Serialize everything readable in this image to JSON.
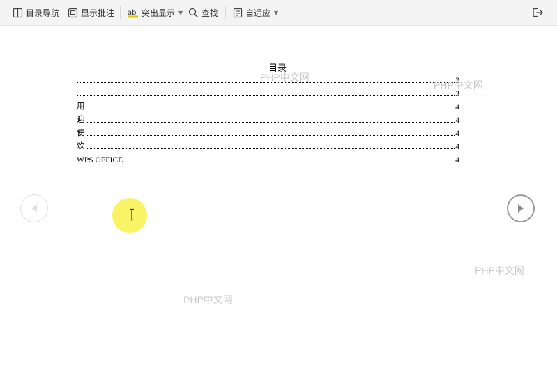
{
  "toolbar": {
    "toc_nav_label": "目录导航",
    "show_comments_label": "显示批注",
    "highlight_label": "突出显示",
    "find_label": "查找",
    "fit_label": "自适应"
  },
  "document": {
    "toc_title": "目录",
    "toc_entries": [
      {
        "text": "",
        "page": "3"
      },
      {
        "text": "",
        "page": "3"
      },
      {
        "text": "用",
        "page": "4"
      },
      {
        "text": "迎",
        "page": "4"
      },
      {
        "text": "使",
        "page": "4"
      },
      {
        "text": "欢",
        "page": "4"
      },
      {
        "text": "WPS OFFICE",
        "page": "4"
      }
    ]
  },
  "watermarks": [
    "PHP中文网",
    "PHP中文网",
    "PHP中文网",
    "PHP中文网"
  ],
  "colors": {
    "toolbar_bg": "#f4f4f4",
    "highlight_yellow": "#f7f24a",
    "watermark": "#c9c9c9"
  }
}
